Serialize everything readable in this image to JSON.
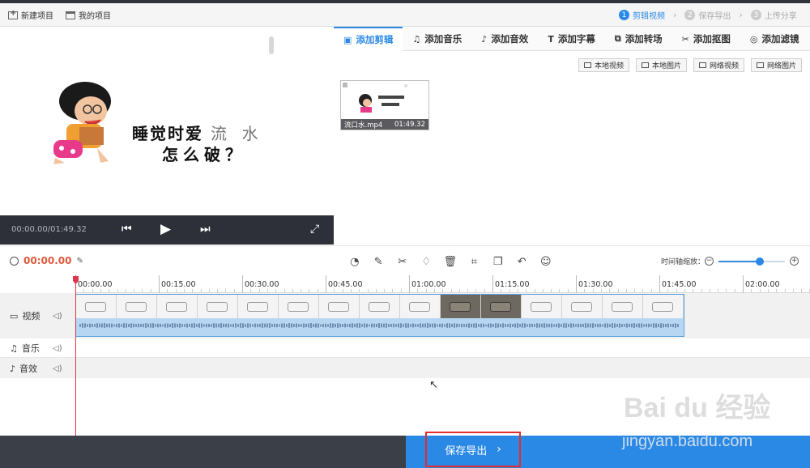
{
  "header": {
    "new_project": "新建项目",
    "my_projects": "我的项目",
    "steps": [
      {
        "num": "1",
        "label": "剪辑视频",
        "active": true
      },
      {
        "num": "2",
        "label": "保存导出",
        "active": false
      },
      {
        "num": "3",
        "label": "上传分享",
        "active": false
      }
    ]
  },
  "preview": {
    "line1_main": "睡觉时爱",
    "line1_light": "流  水",
    "line2": "怎么破？",
    "time": "00:00.00/01:49.32"
  },
  "tabs": [
    {
      "label": "添加剪辑",
      "icon": "video-camera-icon"
    },
    {
      "label": "添加音乐",
      "icon": "music-note-icon"
    },
    {
      "label": "添加音效",
      "icon": "sound-effect-icon"
    },
    {
      "label": "添加字幕",
      "icon": "text-t-icon"
    },
    {
      "label": "添加转场",
      "icon": "transition-icon"
    },
    {
      "label": "添加抠图",
      "icon": "cutout-icon"
    },
    {
      "label": "添加滤镜",
      "icon": "filter-icon"
    }
  ],
  "source_buttons": [
    "本地视频",
    "本地图片",
    "网络视频",
    "网络图片"
  ],
  "media": {
    "filename": "流口水.mp4",
    "duration": "01:49.32"
  },
  "toolbar": {
    "current_time": "00:00.00",
    "zoom_label": "时间轴缩放：",
    "zoom_level": 0.62
  },
  "timeline": {
    "ticks": [
      "00:00.00",
      "00:15.00",
      "00:30.00",
      "00:45.00",
      "01:00.00",
      "01:15.00",
      "01:30.00",
      "01:45.00",
      "02:00.00"
    ],
    "tracks": [
      "视频",
      "音乐",
      "音效"
    ]
  },
  "watermark": {
    "brand": "Bai du 经验",
    "url": "jingyan.baidu.com"
  },
  "footer": {
    "export_label": "保存导出"
  },
  "colors": {
    "accent": "#2b89e6",
    "time_red": "#e0583a",
    "highlight_box": "#e52b2b",
    "footer_dark": "#3b3f47"
  }
}
